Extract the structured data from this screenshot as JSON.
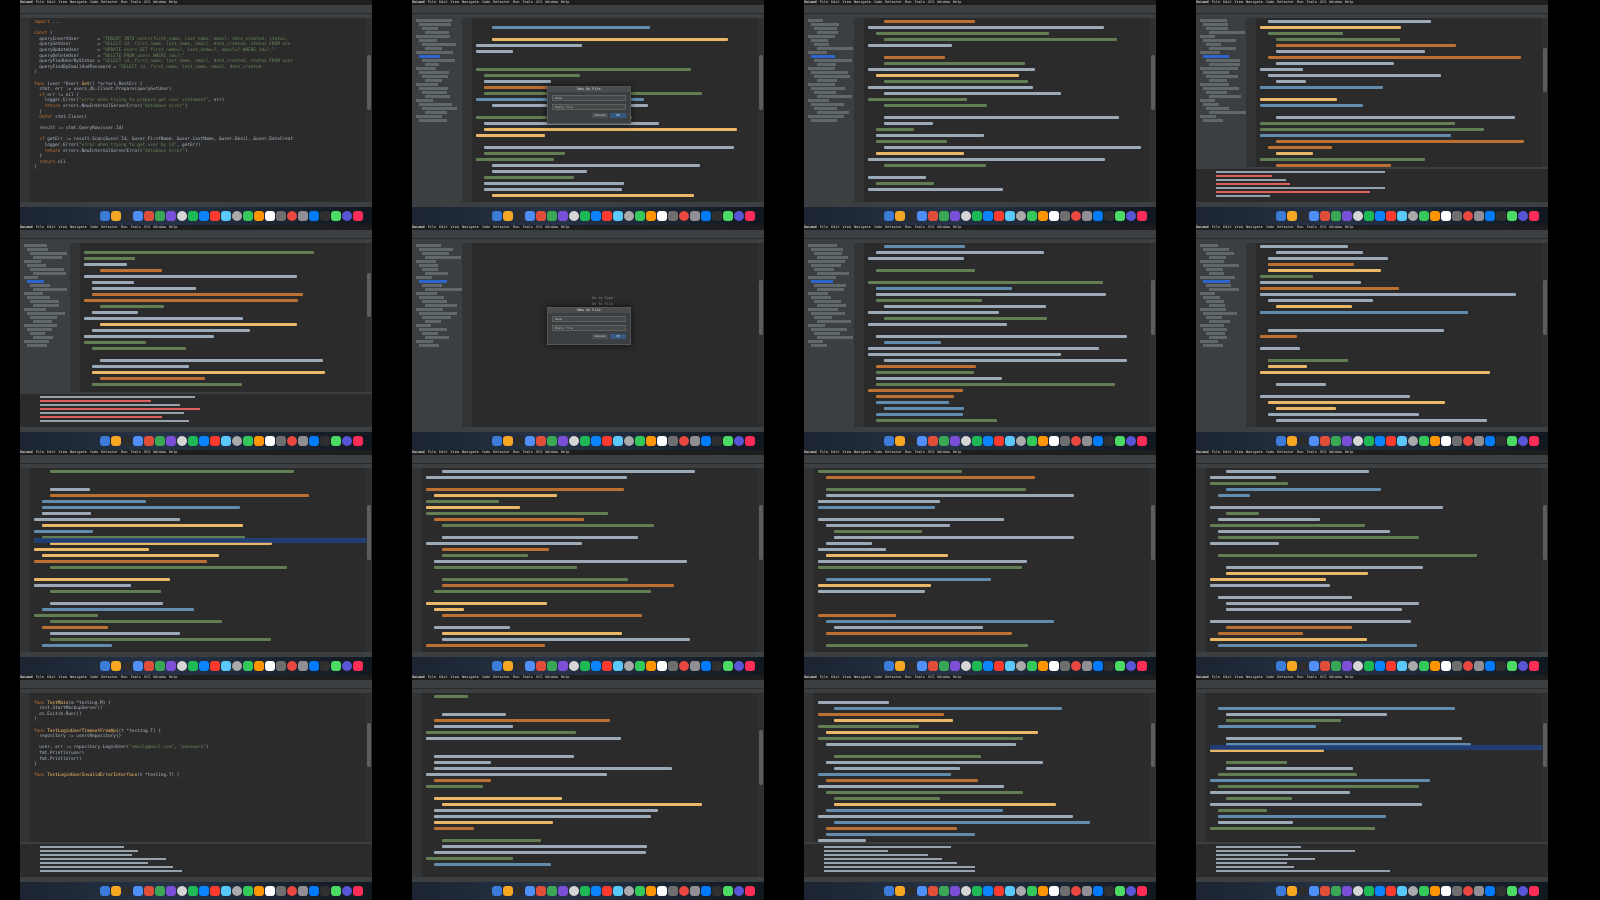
{
  "menu": {
    "app": "GoLand",
    "items": [
      "File",
      "Edit",
      "View",
      "Navigate",
      "Code",
      "Refactor",
      "Run",
      "Tools",
      "VCS",
      "Window",
      "Help"
    ]
  },
  "cells": [
    {
      "id": "c0",
      "kind": "code",
      "sidebar": false,
      "lines": [
        [
          [
            "kw",
            "import "
          ],
          [
            "tx",
            "..."
          ]
        ],
        [
          [
            "tx",
            ""
          ]
        ],
        [
          [
            "kw",
            "const "
          ],
          [
            "tx",
            "("
          ]
        ],
        [
          [
            "tx",
            "  queryInsertUser       = "
          ],
          [
            "str",
            "\"INSERT INTO users(first_name, last_name, email, date_created, status,"
          ]
        ],
        [
          [
            "tx",
            "  queryGetUser          = "
          ],
          [
            "str",
            "\"SELECT id, first_name, last_name, email, date_created, status FROM use"
          ]
        ],
        [
          [
            "tx",
            "  queryUpdateUser       = "
          ],
          [
            "str",
            "\"UPDATE users SET first_name=?, last_name=?, email=? WHERE id=?;\""
          ]
        ],
        [
          [
            "tx",
            "  queryDeleteUser       = "
          ],
          [
            "str",
            "\"DELETE FROM users WHERE id=?;\""
          ]
        ],
        [
          [
            "tx",
            "  queryFindUserByStatus = "
          ],
          [
            "str",
            "\"SELECT id, first_name, last_name, email, date_created, status FROM user"
          ]
        ],
        [
          [
            "tx",
            "  queryFindByEmailAndPassword = "
          ],
          [
            "str",
            "\"SELECT id, first_name, last_name, email, date_created"
          ]
        ],
        [
          [
            "tx",
            ")"
          ]
        ],
        [
          [
            "tx",
            ""
          ]
        ],
        [
          [
            "kw",
            "func "
          ],
          [
            "tx",
            "(user *User) "
          ],
          [
            "fn",
            "Get"
          ],
          [
            "tx",
            "() *errors.RestErr {"
          ]
        ],
        [
          [
            "tx",
            "  stmt, err := users_db.Client.Prepare(queryGetUser)"
          ]
        ],
        [
          [
            "tx",
            "  "
          ],
          [
            "kw",
            "if "
          ],
          [
            "tx",
            "err != nil {"
          ]
        ],
        [
          [
            "tx",
            "    logger.Error("
          ],
          [
            "str",
            "\"error when trying to prepare get user statement\""
          ],
          [
            "tx",
            ", err)"
          ]
        ],
        [
          [
            "tx",
            "    "
          ],
          [
            "kw",
            "return "
          ],
          [
            "tx",
            "errors.NewInternalServerError("
          ],
          [
            "str",
            "\"database error\""
          ],
          [
            "tx",
            ")"
          ]
        ],
        [
          [
            "tx",
            "  }"
          ]
        ],
        [
          [
            "tx",
            "  "
          ],
          [
            "kw",
            "defer "
          ],
          [
            "tx",
            "stmt.Close()"
          ]
        ],
        [
          [
            "tx",
            ""
          ]
        ],
        [
          [
            "tx",
            "  result := stmt.QueryRow(user.Id)"
          ]
        ],
        [
          [
            "tx",
            ""
          ]
        ],
        [
          [
            "tx",
            "  "
          ],
          [
            "kw",
            "if "
          ],
          [
            "tx",
            "getErr := result.Scan(&user.Id, &user.FirstName, &user.LastName, &user.Email, &user.DateCreat"
          ]
        ],
        [
          [
            "tx",
            "    logger.Error("
          ],
          [
            "str",
            "\"error when trying to get user by id\""
          ],
          [
            "tx",
            ", getErr)"
          ]
        ],
        [
          [
            "tx",
            "    "
          ],
          [
            "kw",
            "return "
          ],
          [
            "tx",
            "errors.NewInternalServerError("
          ],
          [
            "str",
            "\"database error\""
          ],
          [
            "tx",
            ")"
          ]
        ],
        [
          [
            "tx",
            "  }"
          ]
        ],
        [
          [
            "tx",
            "  "
          ],
          [
            "kw",
            "return "
          ],
          [
            "tx",
            "nil"
          ]
        ],
        [
          [
            "tx",
            "}"
          ]
        ]
      ]
    },
    {
      "id": "c1",
      "kind": "lines",
      "sidebar": true,
      "dialog": {
        "title": "New Go File",
        "name_label": "Name",
        "kind_label": "Kind",
        "kind_value": "Empty file",
        "cancel": "Cancel",
        "ok": "OK"
      }
    },
    {
      "id": "c2",
      "kind": "lines",
      "sidebar": true
    },
    {
      "id": "c3",
      "kind": "lines",
      "sidebar": true,
      "run": true
    },
    {
      "id": "c4",
      "kind": "lines",
      "sidebar": true,
      "run": true
    },
    {
      "id": "c5",
      "kind": "empty",
      "sidebar": true,
      "hints": [
        "Go to Type",
        "Go to File",
        "Recent Files"
      ],
      "dialog": {
        "title": "New Go File",
        "name_label": "Name",
        "kind_label": "Kind",
        "kind_value": "Empty file",
        "cancel": "Cancel",
        "ok": "OK"
      }
    },
    {
      "id": "c6",
      "kind": "lines",
      "sidebar": true
    },
    {
      "id": "c7",
      "kind": "lines",
      "sidebar": true
    },
    {
      "id": "c8",
      "kind": "lines",
      "sidebar": false,
      "highlight": true
    },
    {
      "id": "c9",
      "kind": "lines",
      "sidebar": false
    },
    {
      "id": "c10",
      "kind": "lines",
      "sidebar": false
    },
    {
      "id": "c11",
      "kind": "lines",
      "sidebar": false
    },
    {
      "id": "c12",
      "kind": "code",
      "sidebar": false,
      "run": true,
      "lines": [
        [
          [
            "tx",
            ""
          ]
        ],
        [
          [
            "kw",
            "func "
          ],
          [
            "fn",
            "TestMain"
          ],
          [
            "tx",
            "(m *testing.M) {"
          ]
        ],
        [
          [
            "tx",
            "  rest.StartMockupServer()"
          ]
        ],
        [
          [
            "tx",
            "  os.Exit(m.Run())"
          ]
        ],
        [
          [
            "tx",
            "}"
          ]
        ],
        [
          [
            "tx",
            ""
          ]
        ],
        [
          [
            "kw",
            "func "
          ],
          [
            "fn",
            "TestLoginUserTimeoutFromApi"
          ],
          [
            "tx",
            "(t *testing.T) {"
          ]
        ],
        [
          [
            "tx",
            "  repository := usersRepository{}"
          ]
        ],
        [
          [
            "tx",
            ""
          ]
        ],
        [
          [
            "tx",
            "  user, err := repository.LoginUser("
          ],
          [
            "str",
            "\"email@gmail.com\""
          ],
          [
            "tx",
            ", "
          ],
          [
            "str",
            "\"password\""
          ],
          [
            "tx",
            ")"
          ]
        ],
        [
          [
            "tx",
            "  fmt.Println(user)"
          ]
        ],
        [
          [
            "tx",
            "  fmt.Println(err)"
          ]
        ],
        [
          [
            "tx",
            "}"
          ]
        ],
        [
          [
            "tx",
            ""
          ]
        ],
        [
          [
            "kw",
            "func "
          ],
          [
            "fn",
            "TestLoginUserInvalidErrorInterface"
          ],
          [
            "tx",
            "(t *testing.T) {"
          ]
        ]
      ]
    },
    {
      "id": "c13",
      "kind": "lines",
      "sidebar": false
    },
    {
      "id": "c14",
      "kind": "lines",
      "sidebar": false,
      "run": true
    },
    {
      "id": "c15",
      "kind": "lines",
      "sidebar": false,
      "run": true,
      "highlight": true
    }
  ],
  "dock_colors": [
    "#3d7bd9",
    "#f5a623",
    "#2c2c2c",
    "#4f8ff7",
    "#e04e39",
    "#3aa757",
    "#7a4fd6",
    "#d6d6d6",
    "#1db954",
    "#0a84ff",
    "#ff3b30",
    "#5ac8fa",
    "#aaaaaa",
    "#34c759",
    "#ff9500",
    "#ffffff",
    "#6e6e6e",
    "#e8483f",
    "#8e8e93",
    "#007aff",
    "#2f2f2f",
    "#4cd964",
    "#5856d6",
    "#ff2d55"
  ],
  "syntax_colors": {
    "kw": "#cc7832",
    "str": "#6a8759",
    "fn": "#ffc66d",
    "tx": "#a9b7c6"
  }
}
